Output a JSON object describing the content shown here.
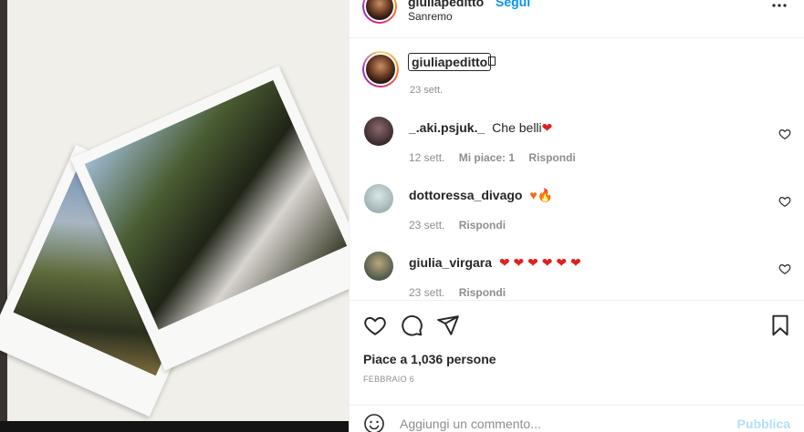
{
  "header": {
    "username": "giuliapeditto",
    "follow_label": "Segui",
    "location": "Sanremo",
    "more_icon": "more-horizontal-icon"
  },
  "caption": {
    "username": "giuliapeditto",
    "time": "23 sett."
  },
  "comments": [
    {
      "username": "_.aki.psjuk._",
      "text": "Che belli",
      "emoji": "❤",
      "time": "12 sett.",
      "likes": "Mi piace: 1",
      "reply": "Rispondi"
    },
    {
      "username": "dottoressa_divago",
      "text": "",
      "emoji": "♥🔥",
      "time": "23 sett.",
      "likes": "",
      "reply": "Rispondi"
    },
    {
      "username": "giulia_virgara",
      "text": "",
      "emoji": "❤ ❤ ❤ ❤ ❤ ❤",
      "time": "23 sett.",
      "likes": "",
      "reply": "Rispondi"
    }
  ],
  "actions": {
    "likes_text": "Piace a 1,036 persone",
    "date": "FEBBRAIO 6"
  },
  "add_comment": {
    "placeholder": "Aggiungi un commento...",
    "publish_label": "Pubblica"
  },
  "colors": {
    "accent": "#0095f6",
    "publish_disabled": "#b2dffc",
    "heart_red": "#e02020"
  }
}
